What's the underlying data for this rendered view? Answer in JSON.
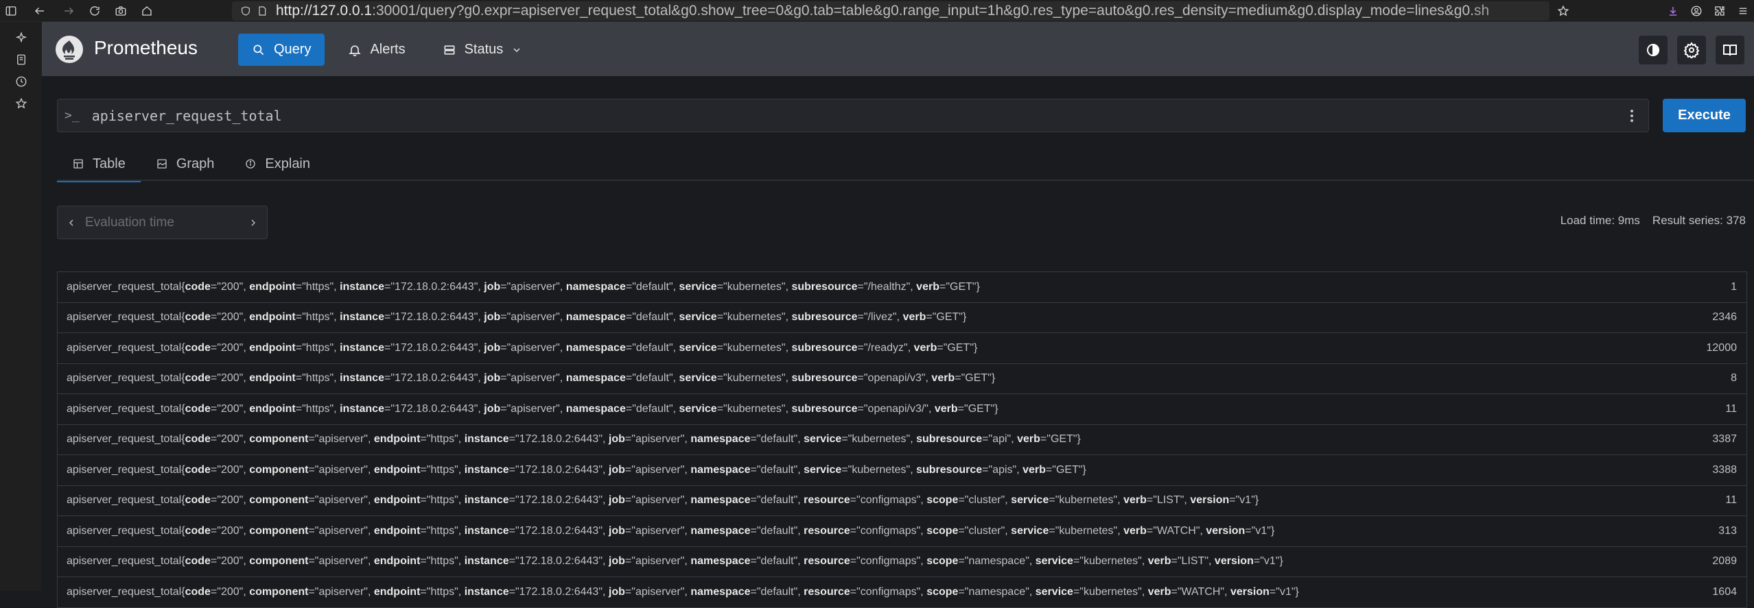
{
  "browser": {
    "url_host": "http://127.0.0.1",
    "url_rest": ":30001/query?g0.expr=apiserver_request_total&g0.show_tree=0&g0.tab=table&g0.range_input=1h&g0.res_type=auto&g0.res_density=medium&g0.display_mode=lines&g0.",
    "url_dim": "sh"
  },
  "header": {
    "brand": "Prometheus",
    "nav": [
      {
        "label": "Query",
        "icon": "search-icon",
        "active": true
      },
      {
        "label": "Alerts",
        "icon": "bell-icon"
      },
      {
        "label": "Status",
        "icon": "server-icon"
      }
    ]
  },
  "query": {
    "prompt": ">_",
    "expression": "apiserver_request_total",
    "execute_label": "Execute"
  },
  "tabs": [
    {
      "label": "Table",
      "icon": "table-icon",
      "active": true
    },
    {
      "label": "Graph",
      "icon": "graph-icon"
    },
    {
      "label": "Explain",
      "icon": "info-icon"
    }
  ],
  "eval": {
    "placeholder": "Evaluation time"
  },
  "stats": {
    "load_time": "Load time: 9ms",
    "result_series": "Result series: 378"
  },
  "rows": [
    {
      "metric": "apiserver_request_total",
      "labels": [
        [
          "code",
          "200"
        ],
        [
          "endpoint",
          "https"
        ],
        [
          "instance",
          "172.18.0.2:6443"
        ],
        [
          "job",
          "apiserver"
        ],
        [
          "namespace",
          "default"
        ],
        [
          "service",
          "kubernetes"
        ],
        [
          "subresource",
          "/healthz"
        ],
        [
          "verb",
          "GET"
        ]
      ],
      "value": "1"
    },
    {
      "metric": "apiserver_request_total",
      "labels": [
        [
          "code",
          "200"
        ],
        [
          "endpoint",
          "https"
        ],
        [
          "instance",
          "172.18.0.2:6443"
        ],
        [
          "job",
          "apiserver"
        ],
        [
          "namespace",
          "default"
        ],
        [
          "service",
          "kubernetes"
        ],
        [
          "subresource",
          "/livez"
        ],
        [
          "verb",
          "GET"
        ]
      ],
      "value": "2346"
    },
    {
      "metric": "apiserver_request_total",
      "labels": [
        [
          "code",
          "200"
        ],
        [
          "endpoint",
          "https"
        ],
        [
          "instance",
          "172.18.0.2:6443"
        ],
        [
          "job",
          "apiserver"
        ],
        [
          "namespace",
          "default"
        ],
        [
          "service",
          "kubernetes"
        ],
        [
          "subresource",
          "/readyz"
        ],
        [
          "verb",
          "GET"
        ]
      ],
      "value": "12000"
    },
    {
      "metric": "apiserver_request_total",
      "labels": [
        [
          "code",
          "200"
        ],
        [
          "endpoint",
          "https"
        ],
        [
          "instance",
          "172.18.0.2:6443"
        ],
        [
          "job",
          "apiserver"
        ],
        [
          "namespace",
          "default"
        ],
        [
          "service",
          "kubernetes"
        ],
        [
          "subresource",
          "openapi/v3"
        ],
        [
          "verb",
          "GET"
        ]
      ],
      "value": "8"
    },
    {
      "metric": "apiserver_request_total",
      "labels": [
        [
          "code",
          "200"
        ],
        [
          "endpoint",
          "https"
        ],
        [
          "instance",
          "172.18.0.2:6443"
        ],
        [
          "job",
          "apiserver"
        ],
        [
          "namespace",
          "default"
        ],
        [
          "service",
          "kubernetes"
        ],
        [
          "subresource",
          "openapi/v3/"
        ],
        [
          "verb",
          "GET"
        ]
      ],
      "value": "11"
    },
    {
      "metric": "apiserver_request_total",
      "labels": [
        [
          "code",
          "200"
        ],
        [
          "component",
          "apiserver"
        ],
        [
          "endpoint",
          "https"
        ],
        [
          "instance",
          "172.18.0.2:6443"
        ],
        [
          "job",
          "apiserver"
        ],
        [
          "namespace",
          "default"
        ],
        [
          "service",
          "kubernetes"
        ],
        [
          "subresource",
          "api"
        ],
        [
          "verb",
          "GET"
        ]
      ],
      "value": "3387"
    },
    {
      "metric": "apiserver_request_total",
      "labels": [
        [
          "code",
          "200"
        ],
        [
          "component",
          "apiserver"
        ],
        [
          "endpoint",
          "https"
        ],
        [
          "instance",
          "172.18.0.2:6443"
        ],
        [
          "job",
          "apiserver"
        ],
        [
          "namespace",
          "default"
        ],
        [
          "service",
          "kubernetes"
        ],
        [
          "subresource",
          "apis"
        ],
        [
          "verb",
          "GET"
        ]
      ],
      "value": "3388"
    },
    {
      "metric": "apiserver_request_total",
      "labels": [
        [
          "code",
          "200"
        ],
        [
          "component",
          "apiserver"
        ],
        [
          "endpoint",
          "https"
        ],
        [
          "instance",
          "172.18.0.2:6443"
        ],
        [
          "job",
          "apiserver"
        ],
        [
          "namespace",
          "default"
        ],
        [
          "resource",
          "configmaps"
        ],
        [
          "scope",
          "cluster"
        ],
        [
          "service",
          "kubernetes"
        ],
        [
          "verb",
          "LIST"
        ],
        [
          "version",
          "v1"
        ]
      ],
      "value": "11"
    },
    {
      "metric": "apiserver_request_total",
      "labels": [
        [
          "code",
          "200"
        ],
        [
          "component",
          "apiserver"
        ],
        [
          "endpoint",
          "https"
        ],
        [
          "instance",
          "172.18.0.2:6443"
        ],
        [
          "job",
          "apiserver"
        ],
        [
          "namespace",
          "default"
        ],
        [
          "resource",
          "configmaps"
        ],
        [
          "scope",
          "cluster"
        ],
        [
          "service",
          "kubernetes"
        ],
        [
          "verb",
          "WATCH"
        ],
        [
          "version",
          "v1"
        ]
      ],
      "value": "313"
    },
    {
      "metric": "apiserver_request_total",
      "labels": [
        [
          "code",
          "200"
        ],
        [
          "component",
          "apiserver"
        ],
        [
          "endpoint",
          "https"
        ],
        [
          "instance",
          "172.18.0.2:6443"
        ],
        [
          "job",
          "apiserver"
        ],
        [
          "namespace",
          "default"
        ],
        [
          "resource",
          "configmaps"
        ],
        [
          "scope",
          "namespace"
        ],
        [
          "service",
          "kubernetes"
        ],
        [
          "verb",
          "LIST"
        ],
        [
          "version",
          "v1"
        ]
      ],
      "value": "2089"
    },
    {
      "metric": "apiserver_request_total",
      "labels": [
        [
          "code",
          "200"
        ],
        [
          "component",
          "apiserver"
        ],
        [
          "endpoint",
          "https"
        ],
        [
          "instance",
          "172.18.0.2:6443"
        ],
        [
          "job",
          "apiserver"
        ],
        [
          "namespace",
          "default"
        ],
        [
          "resource",
          "configmaps"
        ],
        [
          "scope",
          "namespace"
        ],
        [
          "service",
          "kubernetes"
        ],
        [
          "verb",
          "WATCH"
        ],
        [
          "version",
          "v1"
        ]
      ],
      "value": "1604"
    }
  ],
  "colors": {
    "accent": "#1971c2",
    "header": "#3b3e45",
    "background": "#1a1b1e"
  }
}
